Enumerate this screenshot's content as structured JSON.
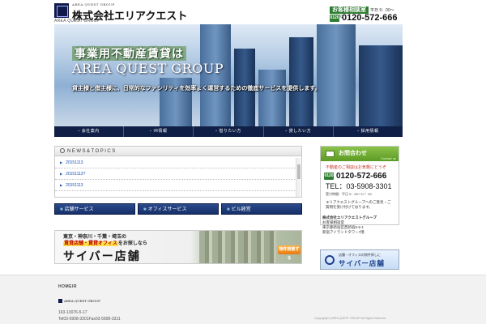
{
  "header": {
    "logo_tiny": "AREA QUEST GROUP",
    "company_name": "株式会社エリアクエスト",
    "company_sub": "AREA QUEST GROUP",
    "contact_tag": "お客様相談室",
    "contact_hours": "平日 9：00～17：00",
    "free_dial_icon": "0120",
    "phone": "0120-572-666"
  },
  "hero": {
    "title_jp": "事業用不動産賃貸は",
    "title_en": "AREA QUEST GROUP",
    "subtitle": "貸主様と借主様に、日常的なファシリティを効率よく運営するための徹底サービスを提供します。"
  },
  "nav": {
    "items": [
      {
        "label": "会社案内"
      },
      {
        "label": "IR情報"
      },
      {
        "label": "借りたい方"
      },
      {
        "label": "貸したい方"
      },
      {
        "label": "採用情報"
      }
    ]
  },
  "news": {
    "title": "NEWS&TOPICS",
    "rows": [
      {
        "text": "20151113"
      },
      {
        "text": "20151113?"
      },
      {
        "text": "20151113"
      }
    ]
  },
  "services": {
    "store": "店舗サービス",
    "office": "オフィスサービス",
    "building": "ビル経営"
  },
  "banner": {
    "line1": "東京・神奈川・千葉・埼玉の",
    "line2_highlight": "賃貸店舗・賃貸オフィス",
    "line2_rest": "をお探しなら",
    "big": "サイバー店舗",
    "button": "物件検索する"
  },
  "inquiry": {
    "title": "お問合わせ",
    "title_sub": "Contact us",
    "note": "不動産のご相談はお気軽にどうぞ",
    "free_dial_icon": "0120",
    "phone": "0120-572-666",
    "tel": "TEL：03-5908-3301",
    "hours": "受付時間：平日 9：00～17：00",
    "message": "エリアクエストグループへのご意見・ご質問を受け付けております。"
  },
  "address": {
    "company": "株式会社エリアクエストグループ",
    "dept": "お客様相談室",
    "line1": "東京都新宿区西新宿6-5-1",
    "line2": "新宿アイランドタワー7階"
  },
  "side_banner": {
    "small": "店舗・オフィスの物件探しに",
    "big": "サイバー店舗"
  },
  "footer": {
    "home": "HOMEIR",
    "logo": "AREA QUEST GROUP",
    "address": "163-13076-5-17",
    "tel": "Tel03-5908-3301Fax03-5908-3311",
    "copyright": "Copyright(C) AREA QUEST GROUP All Rights Reserved."
  }
}
